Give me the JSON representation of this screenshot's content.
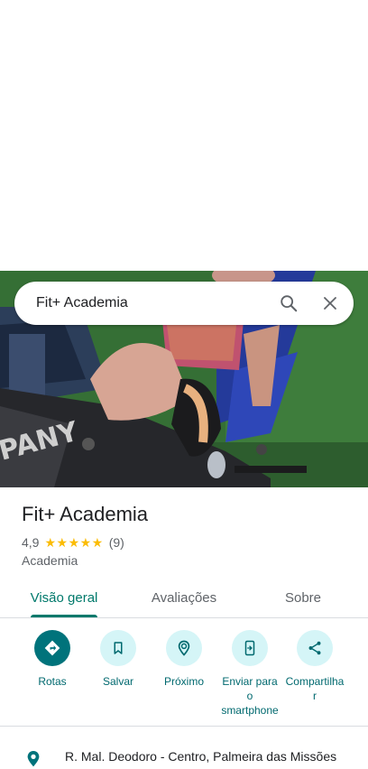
{
  "search": {
    "query": "Fit+ Academia"
  },
  "place": {
    "name": "Fit+ Academia",
    "rating": "4,9",
    "stars": "★★★★★",
    "review_count": "(9)",
    "category": "Academia"
  },
  "tabs": [
    {
      "label": "Visão geral",
      "active": true
    },
    {
      "label": "Avaliações",
      "active": false
    },
    {
      "label": "Sobre",
      "active": false
    }
  ],
  "actions": [
    {
      "label": "Rotas",
      "icon": "directions-icon"
    },
    {
      "label": "Salvar",
      "icon": "bookmark-icon"
    },
    {
      "label": "Próximo",
      "icon": "nearby-icon"
    },
    {
      "label": "Enviar para o smartphone",
      "icon": "send-to-phone-icon"
    },
    {
      "label": "Compartilhar",
      "icon": "share-icon"
    }
  ],
  "address": "R. Mal. Deodoro - Centro, Palmeira das Missões",
  "colors": {
    "accent": "#00796b",
    "chip_bg": "#d5f5f7",
    "primary_chip": "#00737b",
    "star": "#fbbc04"
  }
}
